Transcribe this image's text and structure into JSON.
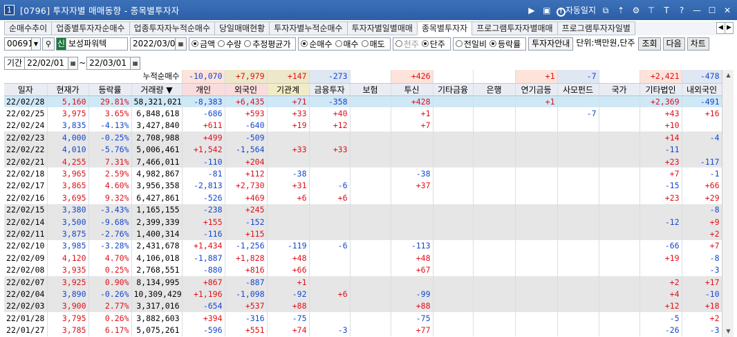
{
  "window": {
    "num": "1",
    "title": "[0796] 투자자별 매매동향 - 종목별투자자",
    "auto_label": "자동일지"
  },
  "tabs": [
    "순매수추이",
    "업종별투자자순매수",
    "업종투자자누적순매수",
    "당일매매현황",
    "투자자별누적순매수",
    "투자자별일별매매",
    "종목별투자자",
    "프로그램투자자별매매",
    "프로그램투자자일별"
  ],
  "active_tab": 6,
  "toolbar": {
    "code": "006910",
    "badge": "신",
    "name": "보성파워텍",
    "date": "2022/03/01",
    "amount": "금액",
    "qty": "수량",
    "est": "추정평균가",
    "net": "순매수",
    "buy": "매수",
    "sell": "매도",
    "thousand": "천주",
    "unit_shares": "단주",
    "prev": "전일비",
    "change": "등락률",
    "guide": "투자자안내",
    "unit_label": "단위:백만원,단주",
    "search": "조회",
    "next": "다음",
    "chart": "차트"
  },
  "period": {
    "label": "기간",
    "from": "22/02/01",
    "to": "22/03/01",
    "cum_label": "누적순매수"
  },
  "headers": [
    "일자",
    "현재가",
    "등락률",
    "거래량",
    "개인",
    "외국인",
    "기관계",
    "금융투자",
    "보험",
    "투신",
    "기타금융",
    "은행",
    "연기금등",
    "사모펀드",
    "국가",
    "기타법인",
    "내외국인"
  ],
  "sums": [
    "-10,070",
    "+7,979",
    "+147",
    "-273",
    "",
    "+426",
    "",
    "",
    "+1",
    "-7",
    "",
    "+2,421",
    "-478"
  ],
  "rows": [
    [
      "22/02/28",
      "5,160",
      "29.81%",
      "58,321,021",
      "-8,383",
      "+6,435",
      "+71",
      "-358",
      "",
      "+428",
      "",
      "",
      "+1",
      "",
      "",
      "+2,369",
      "-491"
    ],
    [
      "22/02/25",
      "3,975",
      "3.65%",
      "6,848,618",
      "-686",
      "+593",
      "+33",
      "+40",
      "",
      "+1",
      "",
      "",
      "",
      "-7",
      "",
      "+43",
      "+16"
    ],
    [
      "22/02/24",
      "3,835",
      "-4.13%",
      "3,427,840",
      "+611",
      "-640",
      "+19",
      "+12",
      "",
      "+7",
      "",
      "",
      "",
      "",
      "",
      "+10",
      ""
    ],
    [
      "22/02/23",
      "4,000",
      "-0.25%",
      "2,708,988",
      "+499",
      "-509",
      "",
      "",
      "",
      "",
      "",
      "",
      "",
      "",
      "",
      "+14",
      "-4"
    ],
    [
      "22/02/22",
      "4,010",
      "-5.76%",
      "5,006,461",
      "+1,542",
      "-1,564",
      "+33",
      "+33",
      "",
      "",
      "",
      "",
      "",
      "",
      "",
      "-11",
      ""
    ],
    [
      "22/02/21",
      "4,255",
      "7.31%",
      "7,466,011",
      "-110",
      "+204",
      "",
      "",
      "",
      "",
      "",
      "",
      "",
      "",
      "",
      "+23",
      "-117"
    ],
    [
      "22/02/18",
      "3,965",
      "2.59%",
      "4,982,867",
      "-81",
      "+112",
      "-38",
      "",
      "",
      "-38",
      "",
      "",
      "",
      "",
      "",
      "+7",
      "-1"
    ],
    [
      "22/02/17",
      "3,865",
      "4.60%",
      "3,956,358",
      "-2,813",
      "+2,730",
      "+31",
      "-6",
      "",
      "+37",
      "",
      "",
      "",
      "",
      "",
      "-15",
      "+66"
    ],
    [
      "22/02/16",
      "3,695",
      "9.32%",
      "6,427,861",
      "-526",
      "+469",
      "+6",
      "+6",
      "",
      "",
      "",
      "",
      "",
      "",
      "",
      "+23",
      "+29"
    ],
    [
      "22/02/15",
      "3,380",
      "-3.43%",
      "1,165,155",
      "-238",
      "+245",
      "",
      "",
      "",
      "",
      "",
      "",
      "",
      "",
      "",
      "",
      "-8"
    ],
    [
      "22/02/14",
      "3,500",
      "-9.68%",
      "2,399,339",
      "+155",
      "-152",
      "",
      "",
      "",
      "",
      "",
      "",
      "",
      "",
      "",
      "-12",
      "+9"
    ],
    [
      "22/02/11",
      "3,875",
      "-2.76%",
      "1,400,314",
      "-116",
      "+115",
      "",
      "",
      "",
      "",
      "",
      "",
      "",
      "",
      "",
      "",
      "+2"
    ],
    [
      "22/02/10",
      "3,985",
      "-3.28%",
      "2,431,678",
      "+1,434",
      "-1,256",
      "-119",
      "-6",
      "",
      "-113",
      "",
      "",
      "",
      "",
      "",
      "-66",
      "+7"
    ],
    [
      "22/02/09",
      "4,120",
      "4.70%",
      "4,106,018",
      "-1,887",
      "+1,828",
      "+48",
      "",
      "",
      "+48",
      "",
      "",
      "",
      "",
      "",
      "+19",
      "-8"
    ],
    [
      "22/02/08",
      "3,935",
      "0.25%",
      "2,768,551",
      "-880",
      "+816",
      "+66",
      "",
      "",
      "+67",
      "",
      "",
      "",
      "",
      "",
      "",
      "-3"
    ],
    [
      "22/02/07",
      "3,925",
      "0.90%",
      "8,134,995",
      "+867",
      "-887",
      "+1",
      "",
      "",
      "",
      "",
      "",
      "",
      "",
      "",
      "+2",
      "+17"
    ],
    [
      "22/02/04",
      "3,890",
      "-0.26%",
      "10,309,429",
      "+1,196",
      "-1,098",
      "-92",
      "+6",
      "",
      "-99",
      "",
      "",
      "",
      "",
      "",
      "+4",
      "-10"
    ],
    [
      "22/02/03",
      "3,900",
      "2.77%",
      "3,317,016",
      "-654",
      "+537",
      "+88",
      "",
      "",
      "+88",
      "",
      "",
      "",
      "",
      "",
      "+12",
      "+18"
    ],
    [
      "22/01/28",
      "3,795",
      "0.26%",
      "3,882,603",
      "+394",
      "-316",
      "-75",
      "",
      "",
      "-75",
      "",
      "",
      "",
      "",
      "",
      "-5",
      "+2"
    ],
    [
      "22/01/27",
      "3,785",
      "6.17%",
      "5,075,261",
      "-596",
      "+551",
      "+74",
      "-3",
      "",
      "+77",
      "",
      "",
      "",
      "",
      "",
      "-26",
      "-3"
    ]
  ],
  "row_shading": [
    "sel",
    "",
    "",
    "g",
    "g",
    "g",
    "",
    "",
    "",
    "g",
    "g",
    "g",
    "",
    "",
    "",
    "g",
    "g",
    "g",
    "",
    ""
  ],
  "colors": {
    "red": "#e0101a",
    "blue": "#1547d0",
    "titlebar": "#2c5ea8",
    "selected_row": "#cfe8f6"
  }
}
